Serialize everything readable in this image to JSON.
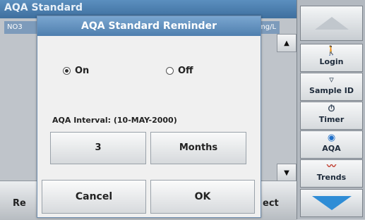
{
  "background": {
    "title": "AQA Standard",
    "list_param": "NO3",
    "list_unit": "mg/L",
    "bottom_left": "Re",
    "bottom_right": "ect"
  },
  "sidebar": {
    "login": "Login",
    "sample_id": "Sample ID",
    "timer": "Timer",
    "aqa": "AQA",
    "trends": "Trends"
  },
  "dialog": {
    "title": "AQA Standard Reminder",
    "radio_on": "On",
    "radio_off": "Off",
    "selected": "On",
    "interval_label": "AQA Interval: (10-MAY-2000)",
    "interval_value": "3",
    "interval_unit": "Months",
    "cancel": "Cancel",
    "ok": "OK"
  }
}
